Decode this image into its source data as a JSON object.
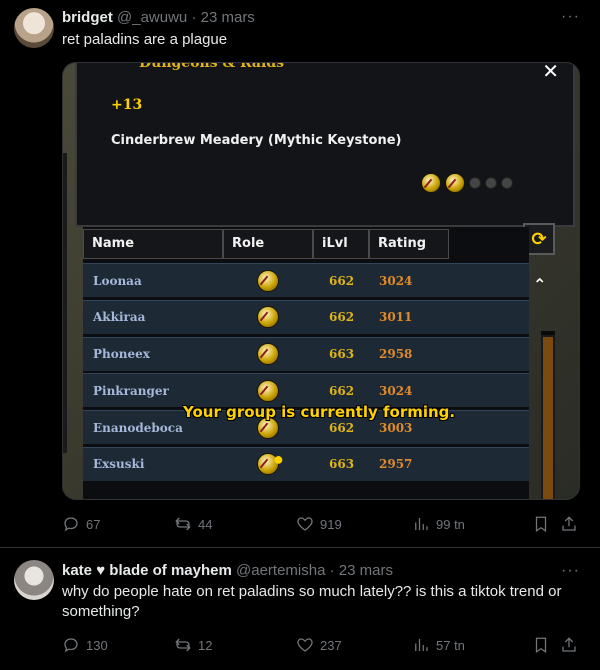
{
  "tweets": [
    {
      "author": "bridget",
      "handle": "@_awuwu",
      "date": "23 mars",
      "text": "ret paladins are a plague",
      "stats": {
        "replies": "67",
        "retweets": "44",
        "likes": "919",
        "views": "99 tn"
      }
    },
    {
      "author_prefix": "kate",
      "author_suffix": "blade of mayhem",
      "handle": "@aertemisha",
      "date": "23 mars",
      "text": "why do people hate on ret paladins so much lately?? is this a tiktok trend or something?",
      "stats": {
        "replies": "130",
        "retweets": "12",
        "likes": "237",
        "views": "57 tn"
      }
    }
  ],
  "game": {
    "header": "Dungeons & Raids",
    "close": "✕",
    "key_level": "+13",
    "dungeon": "Cinderbrew Meadery (Mythic Keystone)",
    "columns": [
      "Name",
      "Role",
      "iLvl",
      "Rating"
    ],
    "rows": [
      {
        "name": "Loonaa",
        "ilvl": "662",
        "rating": "3024"
      },
      {
        "name": "Akkiraa",
        "ilvl": "662",
        "rating": "3011"
      },
      {
        "name": "Phoneex",
        "ilvl": "663",
        "rating": "2958"
      },
      {
        "name": "Pinkranger",
        "ilvl": "662",
        "rating": "3024"
      },
      {
        "name": "Enanodeboca",
        "ilvl": "662",
        "rating": "3003"
      },
      {
        "name": "Exsuski",
        "ilvl": "663",
        "rating": "2957"
      }
    ],
    "status": "Your group is currently forming.",
    "refresh_icon": "refresh-icon",
    "colors": {
      "gold": "#ffd100",
      "rating": "#e08a28",
      "name": "#a6b8d8"
    }
  },
  "icons": {
    "more": "···",
    "heart": "♥"
  }
}
